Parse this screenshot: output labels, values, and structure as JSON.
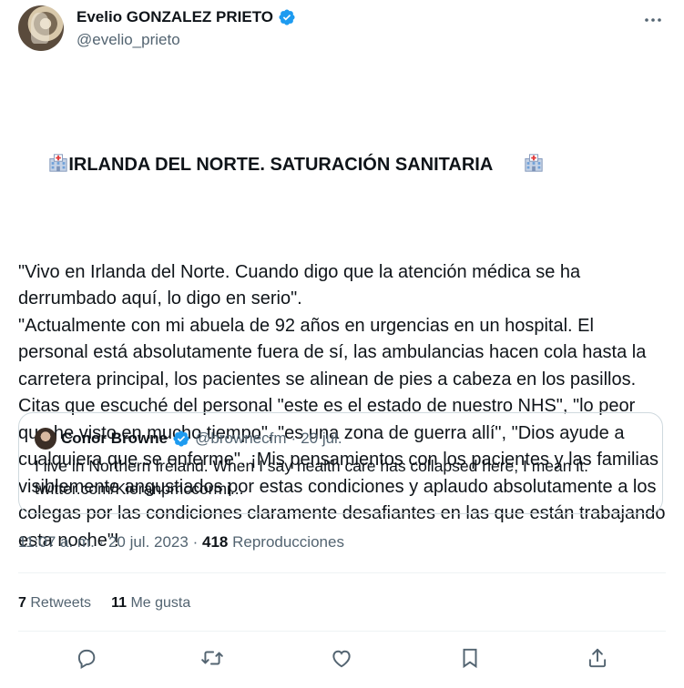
{
  "author": {
    "name": "Evelio GONZALEZ PRIETO",
    "handle": "@evelio_prieto",
    "verified_icon": "verified-badge-icon"
  },
  "tweet": {
    "title": "IRLANDA DEL NORTE. SATURACIÓN SANITARIA",
    "title_icon": "hospital-icon",
    "body": "\"Vivo en Irlanda del Norte. Cuando digo que la atención médica se ha derrumbado aquí, lo digo en serio\".\n\"Actualmente con mi abuela de 92 años en urgencias en un hospital. El personal está absolutamente fuera de sí, las ambulancias hacen cola hasta la carretera principal, los pacientes se alinean de pies a cabeza en los pasillos. Citas que escuché del personal \"este es el estado de nuestro NHS\", \"lo peor que he visto en mucho tiempo\", \"es una zona de guerra allí\", \"Dios ayude a cualquiera que se enferme\". ¡Mis pensamientos con los pacientes y las familias visiblemente angustiados por estas condiciones y aplaudo absolutamente a los colegas por las condiciones claramente desafiantes en las que están trabajando esta noche\"!"
  },
  "quoted": {
    "name": "Conor Browne",
    "handle": "@brownecfm",
    "separator": "·",
    "date": "20 jul.",
    "text": "I live in Northern Ireland. When I say health care has collapsed here, I mean it.",
    "link": "twitter.com/Kieranpmccormi..."
  },
  "meta": {
    "time": "11:07 a. m.",
    "separator": "·",
    "date": "20 jul. 2023",
    "views_count": "418",
    "views_label": "Reproducciones"
  },
  "stats": {
    "retweets_count": "7",
    "retweets_label": "Retweets",
    "likes_count": "11",
    "likes_label": "Me gusta"
  },
  "colors": {
    "verified": "#1d9bf0",
    "secondary_text": "#536471",
    "border": "#cfd9de",
    "action_icon": "#536471"
  }
}
